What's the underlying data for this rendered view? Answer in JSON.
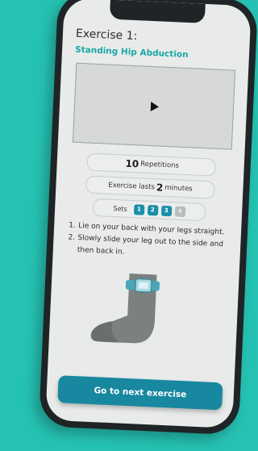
{
  "exercise": {
    "title": "Exercise 1:",
    "name": "Standing Hip Abduction"
  },
  "video": {
    "icon": "play-icon"
  },
  "repetitions": {
    "count": "10",
    "label": "Repetitions"
  },
  "duration": {
    "prefix": "Exercise lasts",
    "value": "2",
    "suffix": "minutes"
  },
  "sets": {
    "label": "Sets",
    "chips": [
      {
        "label": "1",
        "state": "done"
      },
      {
        "label": "2",
        "state": "done"
      },
      {
        "label": "3",
        "state": "done"
      },
      {
        "label": "4",
        "state": "pending"
      }
    ]
  },
  "instructions": [
    {
      "num": "1.",
      "text": "Lie on your back with your legs straight."
    },
    {
      "num": "2.",
      "text": "Slowly slide your leg out to the side and then back in."
    }
  ],
  "cta": {
    "label": "Go to next exercise"
  },
  "colors": {
    "background": "#25c1b2",
    "accent": "#1888a0",
    "subtitle": "#1aa7a4"
  }
}
